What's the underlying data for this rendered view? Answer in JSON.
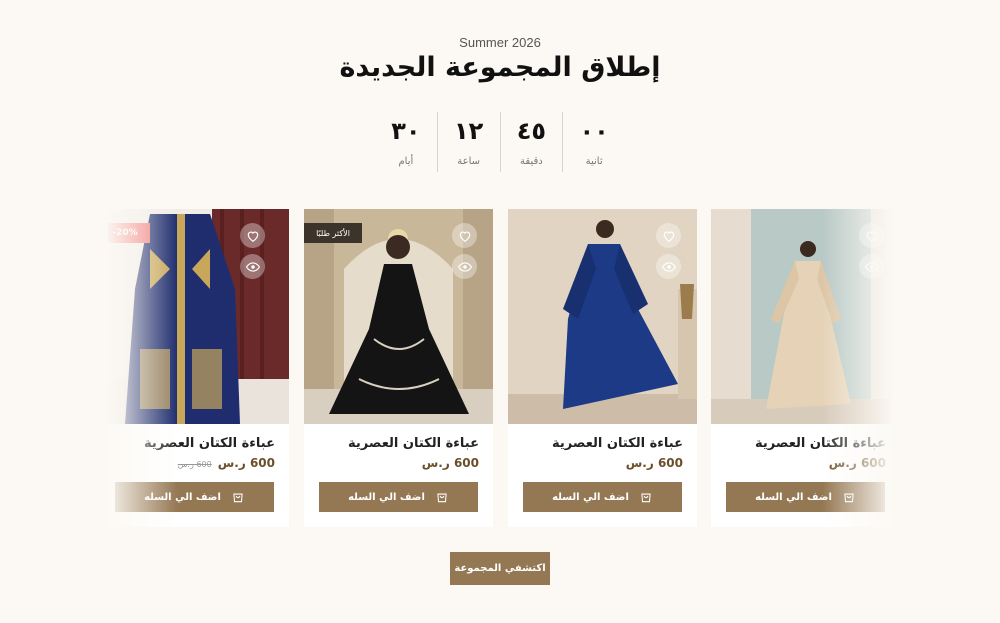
{
  "section": {
    "subtitle": "Summer 2026",
    "title": "إطلاق المجموعة الجديدة"
  },
  "countdown": [
    {
      "value": "٠٠",
      "label": "ثانية"
    },
    {
      "value": "٤٥",
      "label": "دقيقة"
    },
    {
      "value": "١٢",
      "label": "ساعة"
    },
    {
      "value": "٣٠",
      "label": "أيام"
    }
  ],
  "products": [
    {
      "name": "عباءة الكتان العصرية",
      "price": "600 ر.س",
      "old_price": "600 ر.س",
      "badge": "-20%",
      "cart_label": "اضف الي السله",
      "colors": {
        "bg": "#6b2a2a",
        "dress": "#1f2d6e",
        "trim": "#c8a75a"
      }
    },
    {
      "name": "عباءة الكتان العصرية",
      "price": "600 ر.س",
      "old_price": "",
      "badge": "الأكثر طلبًا",
      "cart_label": "اضف الي السله",
      "colors": {
        "bg": "#c9b79a",
        "dress": "#141414",
        "trim": "#d8d0c0"
      }
    },
    {
      "name": "عباءة الكتان العصرية",
      "price": "600 ر.س",
      "old_price": "",
      "badge": "",
      "cart_label": "اضف الي السله",
      "colors": {
        "bg": "#e2d4c2",
        "dress": "#1d3a86",
        "trim": "#1d3a86"
      }
    },
    {
      "name": "عباءة الكتان العصرية",
      "price": "600 ر.س",
      "old_price": "",
      "badge": "",
      "cart_label": "اضف الي السله",
      "colors": {
        "bg": "#b9c9c6",
        "dress": "#e6d3b7",
        "trim": "#e6d3b7"
      }
    }
  ],
  "explore_label": "اكتشفي المجموعة"
}
